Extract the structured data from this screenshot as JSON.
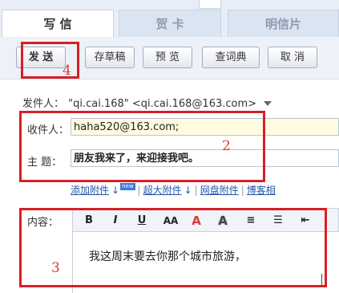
{
  "tabs": [
    {
      "label": "写 信",
      "active": true
    },
    {
      "label": "贺 卡",
      "active": false
    },
    {
      "label": "明信片",
      "active": false
    }
  ],
  "toolbar": {
    "send": "发 送",
    "draft": "存草稿",
    "preview": "预 览",
    "dictionary": "查词典",
    "cancel": "取 消"
  },
  "sender": {
    "label": "发件人：",
    "value": "\"qi.cai.168\" <qi.cai.168@163.com>"
  },
  "recipient": {
    "label": "收件人：",
    "value": "haha520@163.com;"
  },
  "subject": {
    "label": "主 题：",
    "value": "朋友我来了，来迎接我吧。"
  },
  "attachments": {
    "add": "添加附件",
    "add_badge": "new",
    "super": "超大附件",
    "netdisk": "网盘附件",
    "blog": "博客相"
  },
  "editor": {
    "label": "内容：",
    "tools": [
      "B",
      "I",
      "U",
      "AA",
      "A",
      "A",
      "≡",
      "☰",
      "⇤"
    ],
    "body": "我这周末要去你那个城市旅游，"
  },
  "annotations": [
    "4",
    "2",
    "3"
  ],
  "colors": {
    "annotation_red": "#d81f26",
    "link_blue": "#2459a8",
    "font_color_tool": "#d83a3a"
  }
}
